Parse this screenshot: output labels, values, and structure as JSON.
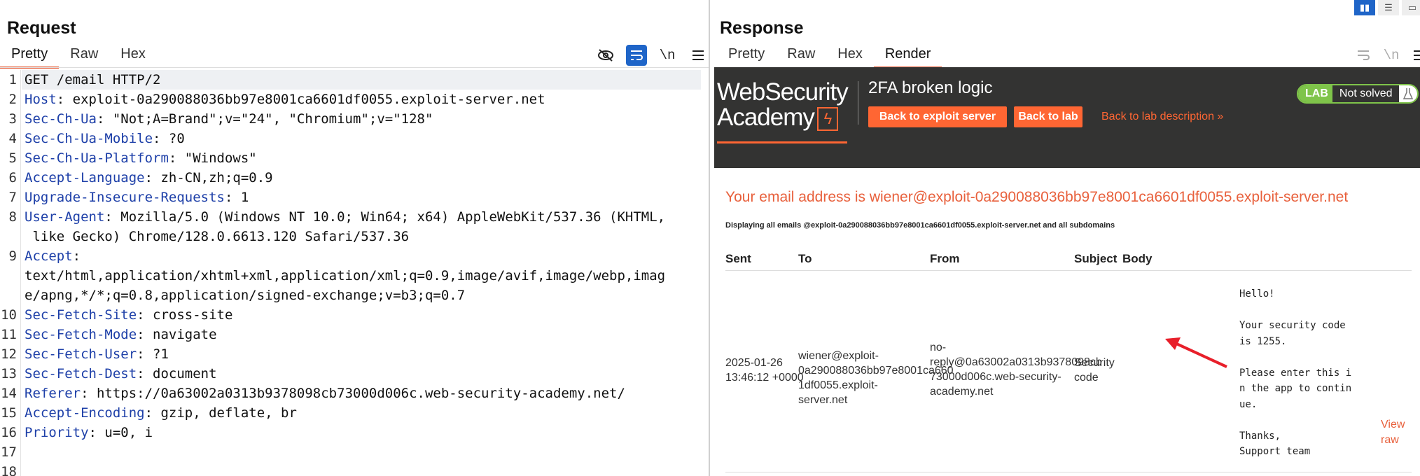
{
  "request": {
    "title": "Request",
    "tabs": [
      "Pretty",
      "Raw",
      "Hex"
    ],
    "active_tab": "Pretty",
    "tools": {
      "eye_hidden": "eye-slash-icon",
      "wrap": "wrap-lines-icon",
      "newline_label": "\\n",
      "menu": "hamburger-menu-icon"
    },
    "lines": [
      {
        "n": "1",
        "key": "",
        "val": "GET /email HTTP/2"
      },
      {
        "n": "2",
        "key": "Host",
        "val": ": exploit-0a290088036bb97e8001ca6601df0055.exploit-server.net"
      },
      {
        "n": "3",
        "key": "Sec-Ch-Ua",
        "val": ": \"Not;A=Brand\";v=\"24\", \"Chromium\";v=\"128\""
      },
      {
        "n": "4",
        "key": "Sec-Ch-Ua-Mobile",
        "val": ": ?0"
      },
      {
        "n": "5",
        "key": "Sec-Ch-Ua-Platform",
        "val": ": \"Windows\""
      },
      {
        "n": "6",
        "key": "Accept-Language",
        "val": ": zh-CN,zh;q=0.9"
      },
      {
        "n": "7",
        "key": "Upgrade-Insecure-Requests",
        "val": ": 1"
      },
      {
        "n": "8",
        "key": "User-Agent",
        "val": ": Mozilla/5.0 (Windows NT 10.0; Win64; x64) AppleWebKit/537.36 (KHTML,"
      },
      {
        "n": "",
        "key": "",
        "val": " like Gecko) Chrome/128.0.6613.120 Safari/537.36"
      },
      {
        "n": "9",
        "key": "Accept",
        "val": ":"
      },
      {
        "n": "",
        "key": "",
        "val": "text/html,application/xhtml+xml,application/xml;q=0.9,image/avif,image/webp,imag"
      },
      {
        "n": "",
        "key": "",
        "val": "e/apng,*/*;q=0.8,application/signed-exchange;v=b3;q=0.7"
      },
      {
        "n": "10",
        "key": "Sec-Fetch-Site",
        "val": ": cross-site"
      },
      {
        "n": "11",
        "key": "Sec-Fetch-Mode",
        "val": ": navigate"
      },
      {
        "n": "12",
        "key": "Sec-Fetch-User",
        "val": ": ?1"
      },
      {
        "n": "13",
        "key": "Sec-Fetch-Dest",
        "val": ": document"
      },
      {
        "n": "14",
        "key": "Referer",
        "val": ": https://0a63002a0313b9378098cb73000d006c.web-security-academy.net/"
      },
      {
        "n": "15",
        "key": "Accept-Encoding",
        "val": ": gzip, deflate, br"
      },
      {
        "n": "16",
        "key": "Priority",
        "val": ": u=0, i"
      },
      {
        "n": "17",
        "key": "",
        "val": ""
      },
      {
        "n": "18",
        "key": "",
        "val": ""
      }
    ]
  },
  "response": {
    "title": "Response",
    "tabs": [
      "Pretty",
      "Raw",
      "Hex",
      "Render"
    ],
    "active_tab": "Render",
    "layout_buttons": [
      "split-vertical-icon",
      "split-horizontal-icon",
      "single-pane-icon"
    ],
    "render": {
      "logo_line1": "WebSecurity",
      "logo_line2": "Academy",
      "logo_bolt": "ϟ",
      "lab_title": "2FA broken logic",
      "btn_exploit": "Back to exploit server",
      "btn_lab": "Back to lab",
      "back_desc": "Back to lab description »",
      "lab_tag": "LAB",
      "lab_status": "Not solved",
      "email_line": "Your email address is wiener@exploit-0a290088036bb97e8001ca6601df0055.exploit-server.net",
      "displaying": "Displaying all emails @exploit-0a290088036bb97e8001ca6601df0055.exploit-server.net and all subdomains",
      "headers": [
        "Sent",
        "To",
        "From",
        "Subject",
        "Body"
      ],
      "row": {
        "sent": [
          "2025-01-26",
          "13:46:12 +0000"
        ],
        "to": [
          "wiener@exploit-",
          "0a290088036bb97e8001ca660",
          "1df0055.exploit-server.net"
        ],
        "from": [
          "no-",
          "reply@0a63002a0313b9378098cb",
          "73000d006c.web-security-",
          "academy.net"
        ],
        "subject": [
          "Security",
          "code"
        ],
        "body": [
          "Hello!",
          "",
          "Your security code",
          "is 1255.",
          "",
          "Please enter this i",
          "n the app to contin",
          "ue.",
          "",
          "Thanks,",
          "Support team"
        ],
        "view_raw": "View raw"
      }
    }
  }
}
